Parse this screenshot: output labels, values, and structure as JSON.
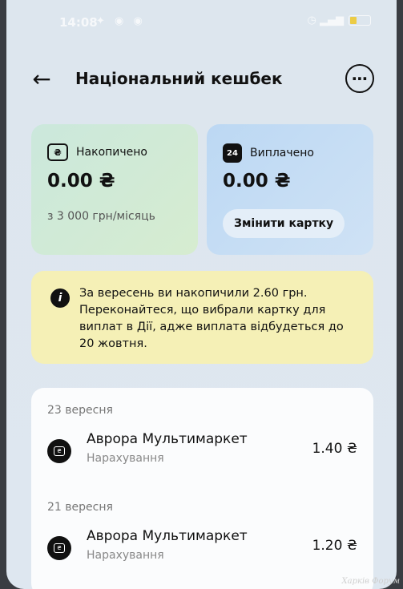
{
  "status_bar": {
    "time": "14:08",
    "left_icons": "✦ ◉ ◉",
    "right_icons": "◷ ▂▄▆"
  },
  "header": {
    "title": "Національний кешбек",
    "back_icon": "←",
    "more_icon": "⋯"
  },
  "cards": {
    "accumulated": {
      "icon": "₴",
      "label": "Накопичено",
      "amount": "0.00 ₴",
      "sub": "з 3 000 грн/місяць"
    },
    "paid": {
      "icon": "24",
      "label": "Виплачено",
      "amount": "0.00 ₴",
      "button": "Змінити картку"
    }
  },
  "info": {
    "icon": "i",
    "text": "За вересень ви накопичили 2.60 грн. Переконайтеся, що вибрали картку для виплат в Дії, адже виплата відбудеться до 20 жовтня."
  },
  "transactions": [
    {
      "date": "23 вересня",
      "merchant": "Аврора Мультимаркет",
      "type": "Нарахування",
      "amount": "1.40 ₴"
    },
    {
      "date": "21 вересня",
      "merchant": "Аврора Мультимаркет",
      "type": "Нарахування",
      "amount": "1.20 ₴"
    }
  ],
  "watermark": "Харків Форум",
  "colors": {
    "accumulated_card": "#cbe8dc",
    "paid_card": "#bcd8f3",
    "info_banner": "#f5f0b6",
    "background": "#dde6ee"
  }
}
